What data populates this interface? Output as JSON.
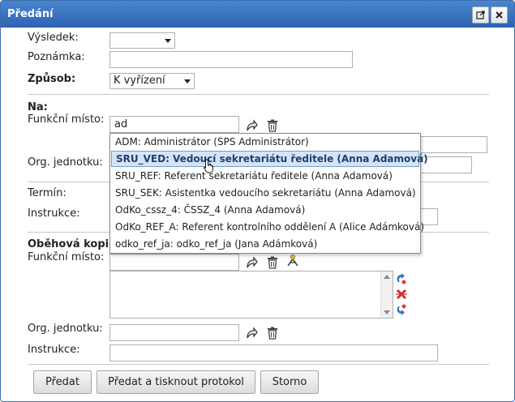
{
  "dialog": {
    "title": "Předání",
    "maximize_icon": "popout-icon",
    "close_icon": "close-icon"
  },
  "form": {
    "vysledek_label": "Výsledek:",
    "vysledek_value": "",
    "poznamka_label": "Poznámka:",
    "poznamka_value": "",
    "zpusob_label": "Způsob:",
    "zpusob_value": "K vyřízení",
    "na_label": "Na:",
    "funkcni_misto_label": "Funkční místo:",
    "funkcni_misto_value": "ad",
    "org_jednotku_label": "Org. jednotku:",
    "termin_label": "Termín:",
    "instrukce_label": "Instrukce:",
    "obehova_kopie_label": "Oběhová kopie",
    "kopie_funkcni_misto_label": "Funkční místo:",
    "kopie_org_jednotku_label": "Org. jednotku:",
    "kopie_instrukce_label": "Instrukce:"
  },
  "autocomplete": {
    "items": [
      "ADM: Administrátor (SPS Administrátor)",
      "SRU_VED: Vedoucí sekretariátu ředitele (Anna Adamová)",
      "SRU_REF: Referent sekretariátu ředitele (Anna Adamová)",
      "SRU_SEK: Asistentka vedoucího sekretariátu (Anna Adamová)",
      "OdKo_cssz_4: ČSSZ_4 (Anna Adamová)",
      "OdKo_REF_A: Referent kontrolního oddělení A (Alice Adámková)",
      "odko_ref_ja: odko_ref_ja (Jana Adámková)"
    ],
    "selected_index": 1
  },
  "buttons": {
    "predat": "Předat",
    "predat_tisk": "Předat a tisknout protokol",
    "storno": "Storno"
  },
  "colors": {
    "titlebar": "#2d62b0",
    "highlight": "#d4e4f6"
  }
}
